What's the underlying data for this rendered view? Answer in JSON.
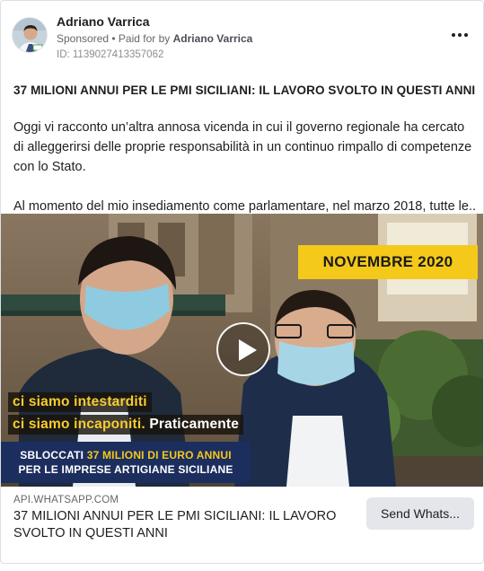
{
  "post": {
    "author": "Adriano Varrica",
    "sponsored": "Sponsored",
    "paid_prefix": "• Paid for by",
    "paid_by": "Adriano Varrica",
    "ad_id": "ID: 1139027413357062",
    "headline": "37 MILIONI ANNUI PER LE PMI SICILIANI: IL LAVORO SVOLTO IN QUESTI ANNI",
    "paragraph1": "Oggi vi racconto un’altra annosa vicenda in cui il governo regionale ha cercato di alleggerirsi delle proprie responsabilità in un continuo rimpallo di competenze con lo Stato.",
    "paragraph2": "Al momento del mio insediamento come parlamentare, nel marzo 2018, tutte le..."
  },
  "video": {
    "banner_top": "NOVEMBRE 2020",
    "subtitle_line1": "ci siamo intestarditi",
    "subtitle_line2_yellow": "ci siamo incaponiti.",
    "subtitle_line2_white": "Praticamente",
    "banner_line1_white": "SBLOCCATI",
    "banner_line1_yellow": "37 MILIONI DI EURO ANNUI",
    "banner_line2": "PER LE IMPRESE ARTIGIANE SICILIANE"
  },
  "link": {
    "domain": "API.WHATSAPP.COM",
    "title": "37 MILIONI ANNUI PER LE PMI SICILIANI: IL LAVORO SVOLTO IN QUESTI ANNI",
    "cta": "Send Whats..."
  },
  "icons": {
    "more": "more-horizontal-icon",
    "play": "play-icon"
  },
  "colors": {
    "banner_yellow": "#f4c91a",
    "banner_navy": "#1c2e5e",
    "cta_bg": "#e4e6eb"
  }
}
